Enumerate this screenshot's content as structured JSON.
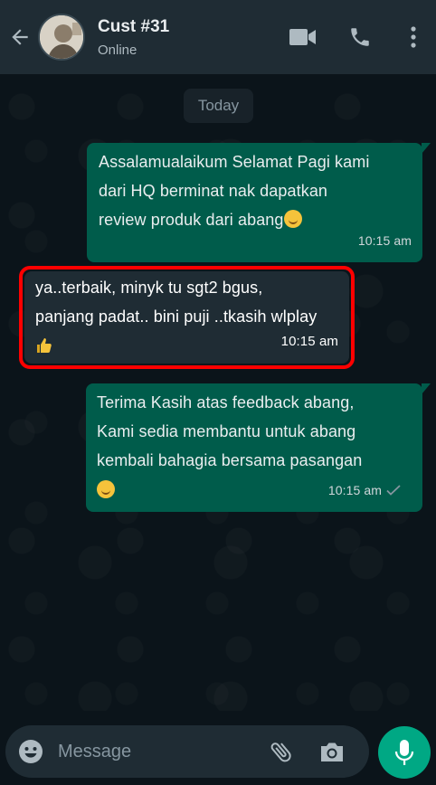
{
  "header": {
    "contact_name": "Cust #31",
    "status": "Online"
  },
  "chat": {
    "day_label": "Today",
    "messages": [
      {
        "direction": "outgoing",
        "text": "Assalamualaikum Selamat Pagi kami\ndari HQ berminat nak dapatkan\nreview produk dari abang",
        "emoji": "smiling-face",
        "time": "10:15 am"
      },
      {
        "direction": "incoming",
        "text": "ya..terbaik, minyk tu sgt2 bgus,\npanjang padat.. bini puji ..tkasih wlplay",
        "emoji": "thumbs-up",
        "time": "10:15 am",
        "highlighted": true
      },
      {
        "direction": "outgoing",
        "text": "Terima Kasih atas feedback abang,\nKami sedia membantu untuk abang\nkembali bahagia bersama pasangan",
        "emoji": "smiling-face",
        "time": "10:15 am",
        "ticks": "single-check"
      }
    ]
  },
  "footer": {
    "placeholder": "Message"
  },
  "colors": {
    "header_bg": "#1f2c34",
    "chat_bg": "#0b141a",
    "outgoing_bubble": "#005c4b",
    "incoming_bubble": "#1f2c34",
    "accent": "#00a884",
    "highlight_border": "#ff0000"
  }
}
